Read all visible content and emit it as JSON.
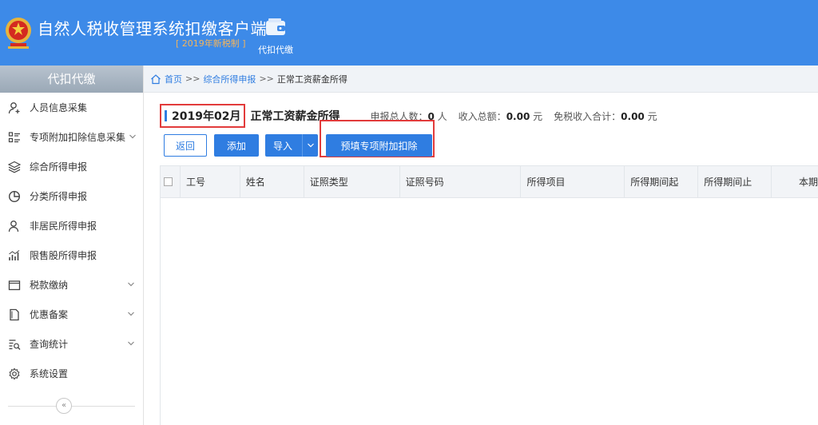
{
  "app": {
    "title": "自然人税收管理系统扣缴客户端",
    "version": "[ 2019年新税制 ]",
    "top_module_label": "代扣代缴"
  },
  "sidebar": {
    "title": "代扣代缴",
    "items": [
      {
        "label": "人员信息采集",
        "icon": "user-collect-icon",
        "expandable": false
      },
      {
        "label": "专项附加扣除信息采集",
        "icon": "list-icon",
        "expandable": true
      },
      {
        "label": "综合所得申报",
        "icon": "layers-icon",
        "expandable": false
      },
      {
        "label": "分类所得申报",
        "icon": "pie-chart-icon",
        "expandable": false
      },
      {
        "label": "非居民所得申报",
        "icon": "person-icon",
        "expandable": false
      },
      {
        "label": "限售股所得申报",
        "icon": "bar-chart-icon",
        "expandable": false
      },
      {
        "label": "税款缴纳",
        "icon": "folder-icon",
        "expandable": true
      },
      {
        "label": "优惠备案",
        "icon": "document-icon",
        "expandable": true
      },
      {
        "label": "查询统计",
        "icon": "search-list-icon",
        "expandable": true
      },
      {
        "label": "系统设置",
        "icon": "gear-icon",
        "expandable": false
      }
    ],
    "collapse_symbol": "«"
  },
  "breadcrumb": {
    "home": "首页",
    "sep1": ">>",
    "level2": "综合所得申报",
    "sep2": ">>",
    "current": "正常工资薪金所得"
  },
  "summary": {
    "period": "2019年02月",
    "income_type": "正常工资薪金所得",
    "total_people_label": "申报总人数：",
    "total_people_value": "0",
    "total_people_unit": "人",
    "total_income_label": "收入总额：",
    "total_income_value": "0.00",
    "total_income_unit": "元",
    "tax_free_label": "免税收入合计：",
    "tax_free_value": "0.00",
    "tax_free_unit": "元"
  },
  "toolbar": {
    "back": "返回",
    "add": "添加",
    "import": "导入",
    "prefill": "预填专项附加扣除"
  },
  "table": {
    "columns": [
      "工号",
      "姓名",
      "证照类型",
      "证照号码",
      "所得项目",
      "所得期间起",
      "所得期间止",
      "本期"
    ],
    "rows": []
  },
  "colors": {
    "header_bg": "#3d8ae8",
    "accent": "#2f7de1",
    "highlight_border": "#e23b3b",
    "version_text": "#f5b45a"
  }
}
